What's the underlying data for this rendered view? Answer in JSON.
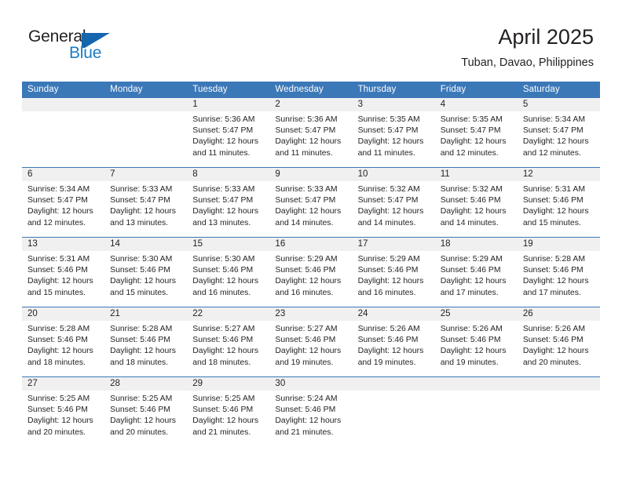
{
  "brand": {
    "name_part1": "General",
    "name_part2": "Blue",
    "accent_color": "#1a7bc4",
    "header_color": "#3b78b8"
  },
  "header": {
    "title": "April 2025",
    "subtitle": "Tuban, Davao, Philippines"
  },
  "calendar": {
    "weekday_headers": [
      "Sunday",
      "Monday",
      "Tuesday",
      "Wednesday",
      "Thursday",
      "Friday",
      "Saturday"
    ],
    "weeks": [
      [
        {
          "day": "",
          "lines": []
        },
        {
          "day": "",
          "lines": []
        },
        {
          "day": "1",
          "lines": [
            "Sunrise: 5:36 AM",
            "Sunset: 5:47 PM",
            "Daylight: 12 hours and 11 minutes."
          ]
        },
        {
          "day": "2",
          "lines": [
            "Sunrise: 5:36 AM",
            "Sunset: 5:47 PM",
            "Daylight: 12 hours and 11 minutes."
          ]
        },
        {
          "day": "3",
          "lines": [
            "Sunrise: 5:35 AM",
            "Sunset: 5:47 PM",
            "Daylight: 12 hours and 11 minutes."
          ]
        },
        {
          "day": "4",
          "lines": [
            "Sunrise: 5:35 AM",
            "Sunset: 5:47 PM",
            "Daylight: 12 hours and 12 minutes."
          ]
        },
        {
          "day": "5",
          "lines": [
            "Sunrise: 5:34 AM",
            "Sunset: 5:47 PM",
            "Daylight: 12 hours and 12 minutes."
          ]
        }
      ],
      [
        {
          "day": "6",
          "lines": [
            "Sunrise: 5:34 AM",
            "Sunset: 5:47 PM",
            "Daylight: 12 hours and 12 minutes."
          ]
        },
        {
          "day": "7",
          "lines": [
            "Sunrise: 5:33 AM",
            "Sunset: 5:47 PM",
            "Daylight: 12 hours and 13 minutes."
          ]
        },
        {
          "day": "8",
          "lines": [
            "Sunrise: 5:33 AM",
            "Sunset: 5:47 PM",
            "Daylight: 12 hours and 13 minutes."
          ]
        },
        {
          "day": "9",
          "lines": [
            "Sunrise: 5:33 AM",
            "Sunset: 5:47 PM",
            "Daylight: 12 hours and 14 minutes."
          ]
        },
        {
          "day": "10",
          "lines": [
            "Sunrise: 5:32 AM",
            "Sunset: 5:47 PM",
            "Daylight: 12 hours and 14 minutes."
          ]
        },
        {
          "day": "11",
          "lines": [
            "Sunrise: 5:32 AM",
            "Sunset: 5:46 PM",
            "Daylight: 12 hours and 14 minutes."
          ]
        },
        {
          "day": "12",
          "lines": [
            "Sunrise: 5:31 AM",
            "Sunset: 5:46 PM",
            "Daylight: 12 hours and 15 minutes."
          ]
        }
      ],
      [
        {
          "day": "13",
          "lines": [
            "Sunrise: 5:31 AM",
            "Sunset: 5:46 PM",
            "Daylight: 12 hours and 15 minutes."
          ]
        },
        {
          "day": "14",
          "lines": [
            "Sunrise: 5:30 AM",
            "Sunset: 5:46 PM",
            "Daylight: 12 hours and 15 minutes."
          ]
        },
        {
          "day": "15",
          "lines": [
            "Sunrise: 5:30 AM",
            "Sunset: 5:46 PM",
            "Daylight: 12 hours and 16 minutes."
          ]
        },
        {
          "day": "16",
          "lines": [
            "Sunrise: 5:29 AM",
            "Sunset: 5:46 PM",
            "Daylight: 12 hours and 16 minutes."
          ]
        },
        {
          "day": "17",
          "lines": [
            "Sunrise: 5:29 AM",
            "Sunset: 5:46 PM",
            "Daylight: 12 hours and 16 minutes."
          ]
        },
        {
          "day": "18",
          "lines": [
            "Sunrise: 5:29 AM",
            "Sunset: 5:46 PM",
            "Daylight: 12 hours and 17 minutes."
          ]
        },
        {
          "day": "19",
          "lines": [
            "Sunrise: 5:28 AM",
            "Sunset: 5:46 PM",
            "Daylight: 12 hours and 17 minutes."
          ]
        }
      ],
      [
        {
          "day": "20",
          "lines": [
            "Sunrise: 5:28 AM",
            "Sunset: 5:46 PM",
            "Daylight: 12 hours and 18 minutes."
          ]
        },
        {
          "day": "21",
          "lines": [
            "Sunrise: 5:28 AM",
            "Sunset: 5:46 PM",
            "Daylight: 12 hours and 18 minutes."
          ]
        },
        {
          "day": "22",
          "lines": [
            "Sunrise: 5:27 AM",
            "Sunset: 5:46 PM",
            "Daylight: 12 hours and 18 minutes."
          ]
        },
        {
          "day": "23",
          "lines": [
            "Sunrise: 5:27 AM",
            "Sunset: 5:46 PM",
            "Daylight: 12 hours and 19 minutes."
          ]
        },
        {
          "day": "24",
          "lines": [
            "Sunrise: 5:26 AM",
            "Sunset: 5:46 PM",
            "Daylight: 12 hours and 19 minutes."
          ]
        },
        {
          "day": "25",
          "lines": [
            "Sunrise: 5:26 AM",
            "Sunset: 5:46 PM",
            "Daylight: 12 hours and 19 minutes."
          ]
        },
        {
          "day": "26",
          "lines": [
            "Sunrise: 5:26 AM",
            "Sunset: 5:46 PM",
            "Daylight: 12 hours and 20 minutes."
          ]
        }
      ],
      [
        {
          "day": "27",
          "lines": [
            "Sunrise: 5:25 AM",
            "Sunset: 5:46 PM",
            "Daylight: 12 hours and 20 minutes."
          ]
        },
        {
          "day": "28",
          "lines": [
            "Sunrise: 5:25 AM",
            "Sunset: 5:46 PM",
            "Daylight: 12 hours and 20 minutes."
          ]
        },
        {
          "day": "29",
          "lines": [
            "Sunrise: 5:25 AM",
            "Sunset: 5:46 PM",
            "Daylight: 12 hours and 21 minutes."
          ]
        },
        {
          "day": "30",
          "lines": [
            "Sunrise: 5:24 AM",
            "Sunset: 5:46 PM",
            "Daylight: 12 hours and 21 minutes."
          ]
        },
        {
          "day": "",
          "lines": []
        },
        {
          "day": "",
          "lines": []
        },
        {
          "day": "",
          "lines": []
        }
      ]
    ]
  }
}
